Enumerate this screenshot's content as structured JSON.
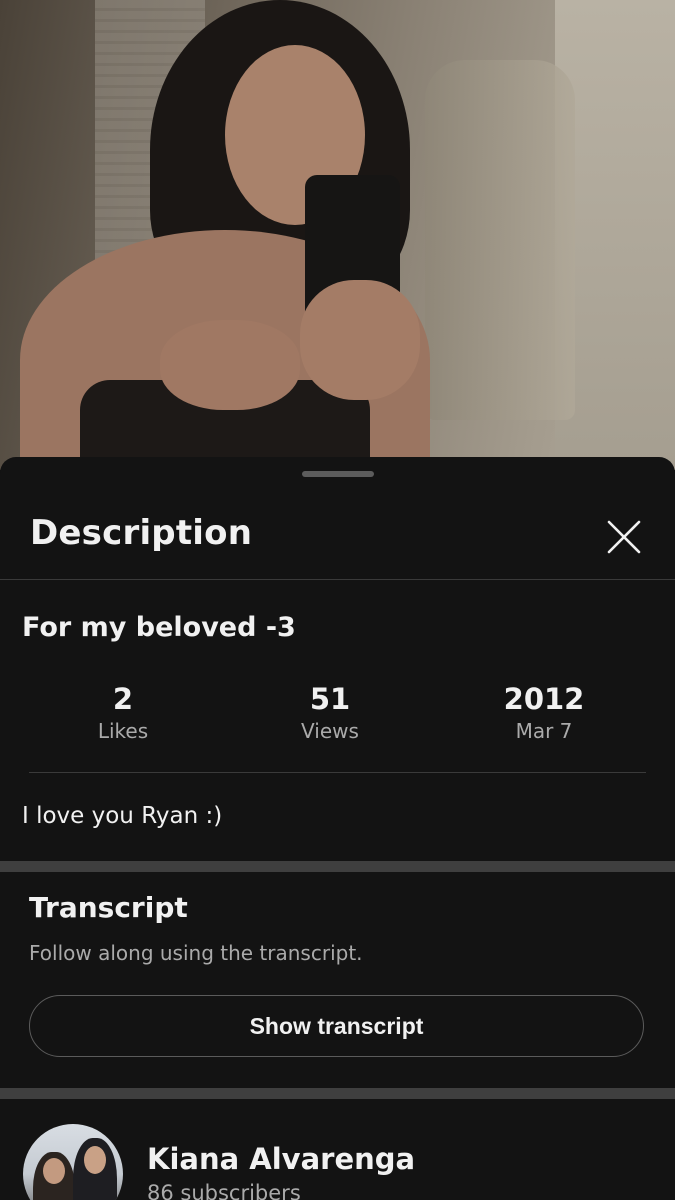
{
  "panel": {
    "title": "Description",
    "close_icon": "close-icon"
  },
  "video": {
    "title": "For my beloved -3",
    "stats": {
      "likes_value": "2",
      "likes_label": "Likes",
      "views_value": "51",
      "views_label": "Views",
      "year": "2012",
      "date": "Mar 7"
    },
    "description": "I love you Ryan :)"
  },
  "transcript": {
    "title": "Transcript",
    "subtitle": "Follow along using the transcript.",
    "button_label": "Show transcript"
  },
  "channel": {
    "name": "Kiana Alvarenga",
    "subscribers": "86 subscribers"
  },
  "colors": {
    "background": "#131313",
    "text_primary": "#f1f1f1",
    "text_secondary": "#aaaaaa",
    "divider": "#3a3a3a"
  }
}
